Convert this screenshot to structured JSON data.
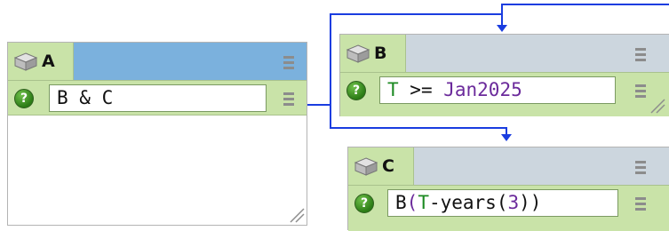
{
  "nodes": {
    "a": {
      "label": "A",
      "expression": "B & C",
      "header_color": "#7bb1dd"
    },
    "b": {
      "label": "B",
      "expression_parts": {
        "t": "T",
        "op": " >= ",
        "date": "Jan2025"
      },
      "header_color": "#ccd6de"
    },
    "c": {
      "label": "C",
      "expression_parts": {
        "fn": "B",
        "open": "(",
        "t": "T",
        "minus": "-years(",
        "num": "3",
        "close": "))"
      },
      "header_color": "#ccd6de"
    }
  },
  "icons": {
    "node": "cube-icon",
    "condition": "question-icon",
    "menu": "hamburger-menu-icon",
    "resize": "resize-corner-icon"
  },
  "colors": {
    "wire": "#1a3de0",
    "row_bg": "#c9e3a8",
    "keyword_green": "#1c8a22",
    "literal_purple": "#6b2a9b"
  }
}
